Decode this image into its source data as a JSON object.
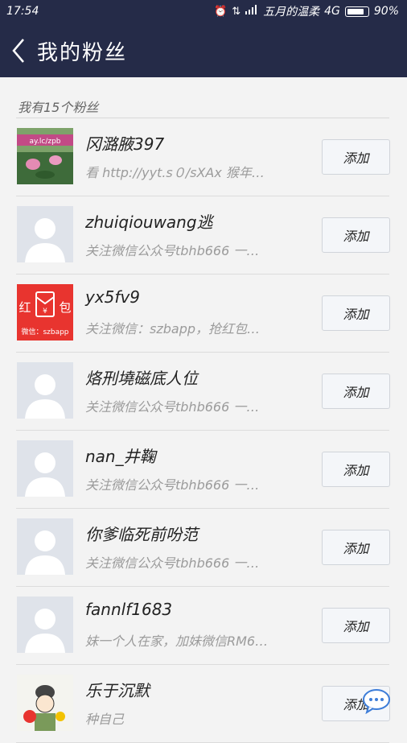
{
  "status_bar": {
    "time": "17:54",
    "carrier": "五月的温柔",
    "network": "4G",
    "battery": "90%",
    "battery_level": 0.9
  },
  "header": {
    "title": "我的粉丝"
  },
  "section_label": "我有15个粉丝",
  "add_label": "添加",
  "fans": [
    {
      "name": "冈潞腋397",
      "signature": "看 http://yyt.s０/sXAx 猴年…",
      "avatar": "lotus-photo"
    },
    {
      "name": "zhuiqiouwang逃",
      "signature": "关注微信公众号tbhb666 一…",
      "avatar": "default-person"
    },
    {
      "name": "yx5fv9",
      "signature": "关注微信：szbapp，抢红包…",
      "avatar": "red-packet",
      "avatar_text": {
        "left": "红",
        "right": "包",
        "bottom": "微信：szbapp"
      }
    },
    {
      "name": "烙刑墝磁底人位",
      "signature": "关注微信公众号tbhb666 一…",
      "avatar": "default-person"
    },
    {
      "name": "nan_井鞠",
      "signature": "关注微信公众号tbhb666 一…",
      "avatar": "default-person"
    },
    {
      "name": "你爹临死前吩范",
      "signature": "关注微信公众号tbhb666 一…",
      "avatar": "default-person"
    },
    {
      "name": "fannlf1683",
      "signature": "妹一个人在家，加妹微信RM6…",
      "avatar": "default-person"
    },
    {
      "name": "乐于沉默",
      "signature": "种自己",
      "avatar": "cartoon"
    }
  ],
  "lotus_overlay_text": "ay.lc/zpb",
  "colors": {
    "header": "#252b48",
    "red_packet": "#e8342f"
  }
}
